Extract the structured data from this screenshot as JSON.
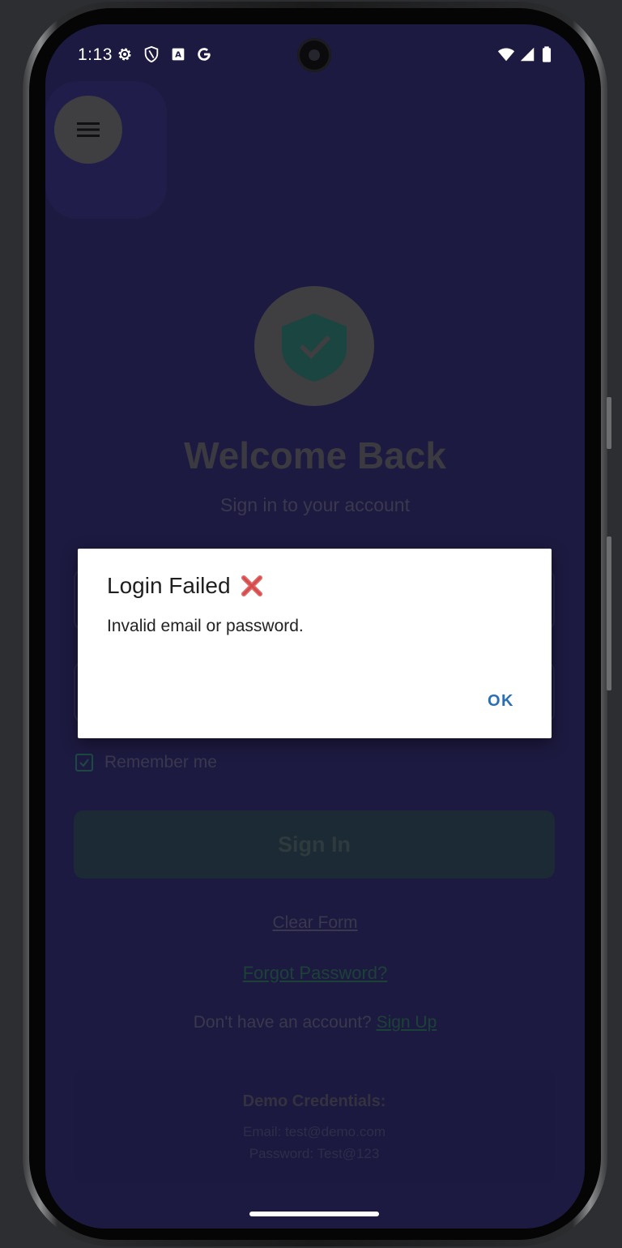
{
  "status_bar": {
    "time": "1:13"
  },
  "login_screen": {
    "title": "Welcome Back",
    "subtitle": "Sign in to your account",
    "remember_me_label": "Remember me",
    "sign_in_label": "Sign In",
    "clear_form_label": "Clear Form",
    "forgot_password_label": "Forgot Password?",
    "signup_prompt": "Don't have an account?",
    "signup_link": "Sign Up",
    "demo": {
      "title": "Demo Credentials:",
      "email_line": "Email: test@demo.com",
      "password_line": "Password: Test@123"
    }
  },
  "dialog": {
    "title": "Login Failed",
    "title_icon": "cross-mark-icon",
    "message": "Invalid email or password.",
    "ok_label": "OK"
  },
  "colors": {
    "screen_background": "#1d1a41",
    "dialog_action": "#2b6fb3",
    "accent_dimmed": "#1c4238",
    "error_mark": "#e06666"
  }
}
